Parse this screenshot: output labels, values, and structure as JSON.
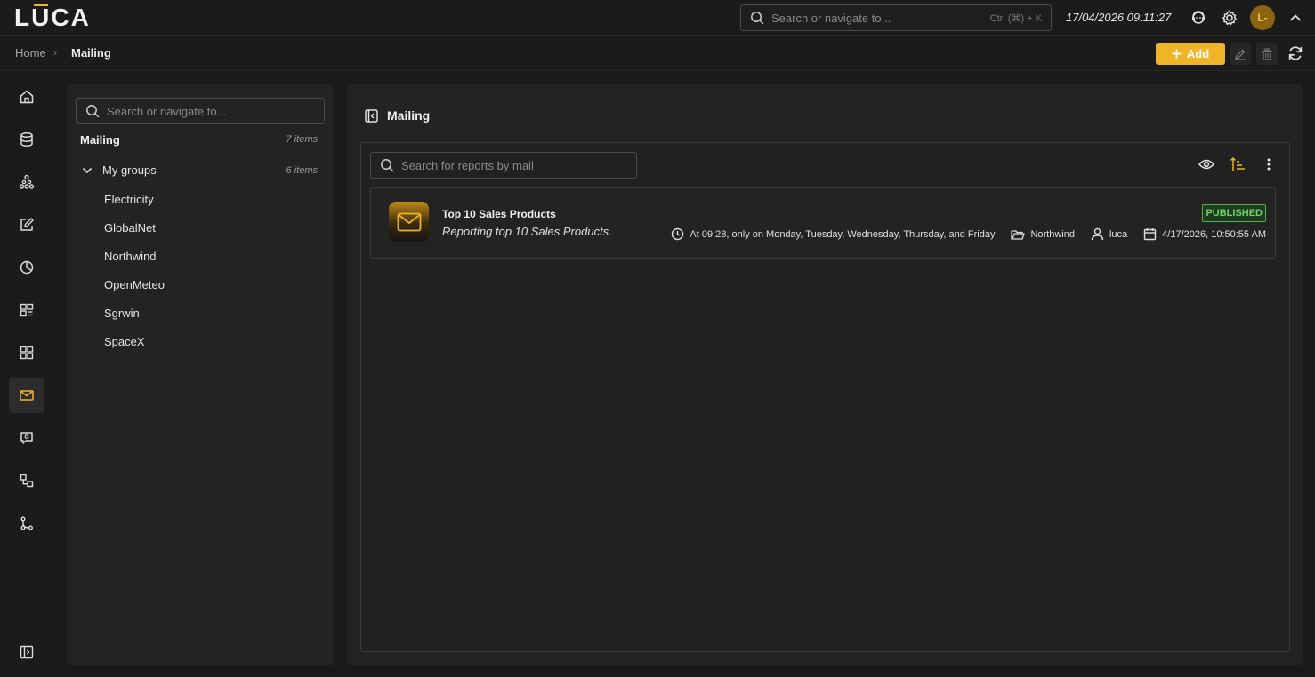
{
  "app": {
    "logo_text": "LUCA",
    "accent_color": "#f0b429"
  },
  "topbar": {
    "search_placeholder": "Search or navigate to...",
    "search_shortcut": "Ctrl (⌘) + K",
    "datetime": "17/04/2026 09:11:27",
    "avatar_initials": "L-"
  },
  "breadcrumb": {
    "home": "Home",
    "current": "Mailing"
  },
  "toolbar": {
    "add_label": "Add"
  },
  "rail": {
    "items": [
      "home-icon",
      "database-icon",
      "network-icon",
      "edit-icon",
      "pie-chart-icon",
      "dashboard-icon",
      "apps-icon",
      "mail-icon",
      "chat-icon",
      "flow-icon",
      "git-branch-icon"
    ],
    "active": "mail-icon"
  },
  "tree": {
    "search_placeholder": "Search or navigate to...",
    "root_label": "Mailing",
    "root_count": "7 items",
    "group_label": "My groups",
    "group_count": "6 items",
    "items": [
      "Electricity",
      "GlobalNet",
      "Northwind",
      "OpenMeteo",
      "Sgrwin",
      "SpaceX"
    ]
  },
  "main": {
    "title": "Mailing",
    "search_placeholder": "Search for reports by mail",
    "report": {
      "title": "Top 10 Sales Products",
      "description": "Reporting top 10 Sales Products",
      "status": "PUBLISHED",
      "schedule": "At 09:28, only on Monday, Tuesday, Wednesday, Thursday, and Friday",
      "folder": "Northwind",
      "user": "luca",
      "date": "4/17/2026, 10:50:55 AM"
    }
  }
}
